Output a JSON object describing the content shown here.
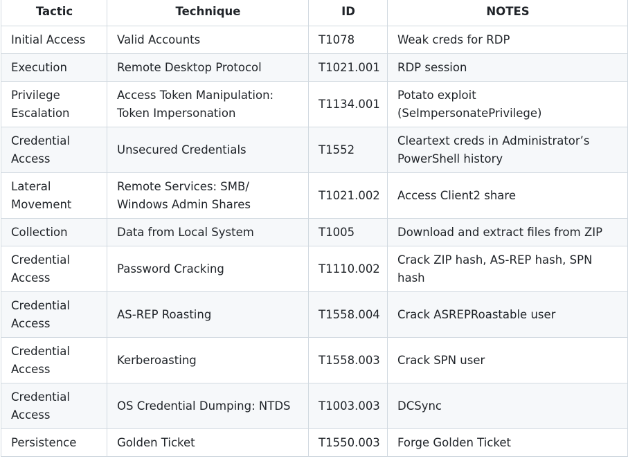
{
  "table": {
    "headers": [
      "Tactic",
      "Technique",
      "ID",
      "NOTES"
    ],
    "rows": [
      {
        "tactic": "Initial Access",
        "technique": "Valid Accounts",
        "id": "T1078",
        "notes": "Weak creds for RDP"
      },
      {
        "tactic": "Execution",
        "technique": "Remote Desktop Protocol",
        "id": "T1021.001",
        "notes": "RDP session"
      },
      {
        "tactic": "Privilege Escalation",
        "technique": "Access Token Manipulation: Token Impersonation",
        "id": "T1134.001",
        "notes": "Potato exploit (SeImpersonatePrivilege)"
      },
      {
        "tactic": "Credential Access",
        "technique": "Unsecured Credentials",
        "id": "T1552",
        "notes": "Cleartext creds in Administrator’s PowerShell history"
      },
      {
        "tactic": "Lateral Movement",
        "technique": "Remote Services: SMB/ Windows Admin Shares",
        "id": "T1021.002",
        "notes": "Access Client2 share"
      },
      {
        "tactic": "Collection",
        "technique": "Data from Local System",
        "id": "T1005",
        "notes": "Download and extract files from ZIP"
      },
      {
        "tactic": "Credential Access",
        "technique": "Password Cracking",
        "id": "T1110.002",
        "notes": "Crack ZIP hash, AS-REP hash, SPN hash"
      },
      {
        "tactic": "Credential Access",
        "technique": "AS-REP Roasting",
        "id": "T1558.004",
        "notes": "Crack ASREPRoastable user"
      },
      {
        "tactic": "Credential Access",
        "technique": "Kerberoasting",
        "id": "T1558.003",
        "notes": "Crack SPN user"
      },
      {
        "tactic": "Credential Access",
        "technique": "OS Credential Dumping: NTDS",
        "id": "T1003.003",
        "notes": "DCSync"
      },
      {
        "tactic": "Persistence",
        "technique": "Golden Ticket",
        "id": "T1550.003",
        "notes": "Forge Golden Ticket"
      }
    ]
  }
}
